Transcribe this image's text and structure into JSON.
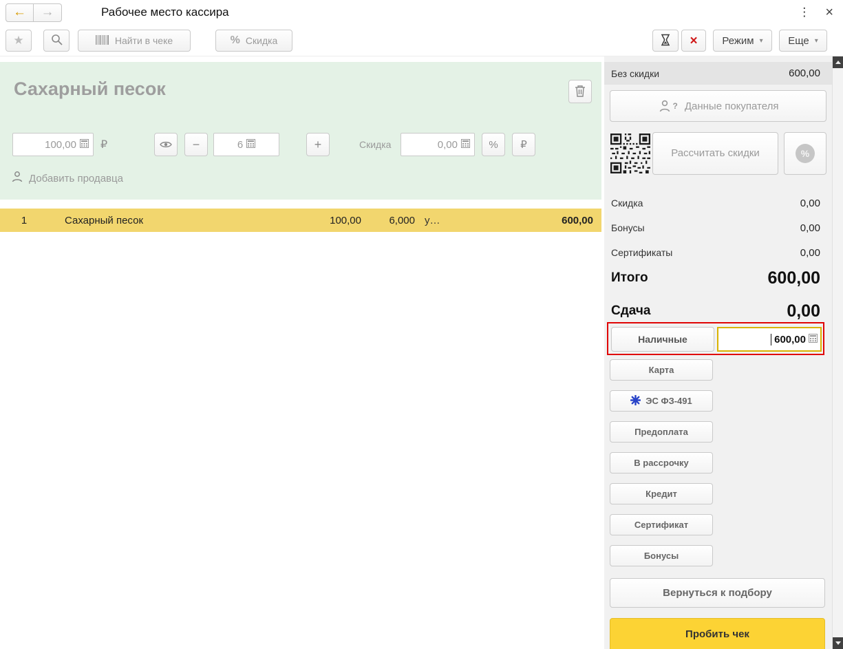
{
  "window": {
    "title": "Рабочее место кассира"
  },
  "icons": {
    "back": "←",
    "forward": "→",
    "star": "★",
    "kebab": "⋮",
    "close": "×",
    "red_x": "×",
    "dropdown": "▾",
    "minus": "−",
    "plus": "+",
    "ruble": "₽",
    "percent": "%",
    "question": "?"
  },
  "toolbar": {
    "find_in_receipt": "Найти в чеке",
    "discount": "Скидка",
    "mode": "Режим",
    "more": "Еще"
  },
  "product_panel": {
    "name": "Сахарный песок",
    "price": "100,00",
    "quantity": "6",
    "discount_label": "Скидка",
    "discount_value": "0,00",
    "add_seller": "Добавить продавца"
  },
  "receipt": {
    "row": {
      "num": "1",
      "name": "Сахарный песок",
      "price": "100,00",
      "qty": "6,000",
      "unit": "у…",
      "sum": "600,00"
    }
  },
  "summary": {
    "no_discount_label": "Без скидки",
    "no_discount_value": "600,00",
    "customer_button": "Данные покупателя",
    "calc_discounts": "Рассчитать скидки",
    "rows": [
      {
        "label": "Скидка",
        "value": "0,00"
      },
      {
        "label": "Бонусы",
        "value": "0,00"
      },
      {
        "label": "Сертификаты",
        "value": "0,00"
      }
    ],
    "total_label": "Итого",
    "total_value": "600,00",
    "change_label": "Сдача",
    "change_value": "0,00"
  },
  "payment": {
    "cash_label": "Наличные",
    "cash_value": "600,00",
    "buttons": [
      "Карта",
      "ЭС ФЗ-491",
      "Предоплата",
      "В рассрочку",
      "Кредит",
      "Сертификат",
      "Бонусы"
    ],
    "back_button": "Вернуться к подбору",
    "submit_button": "Пробить чек"
  }
}
